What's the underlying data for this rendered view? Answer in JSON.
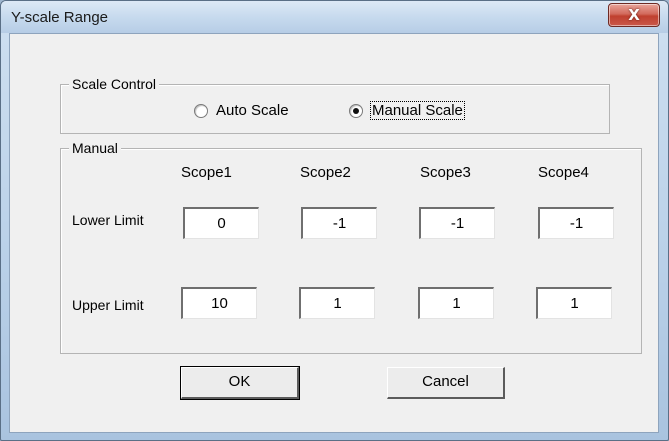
{
  "window": {
    "title": "Y-scale Range",
    "close_label": "X"
  },
  "scale_control": {
    "label": "Scale Control",
    "auto_label": "Auto Scale",
    "manual_label": "Manual Scale",
    "selected": "manual"
  },
  "manual": {
    "label": "Manual",
    "columns": [
      "Scope1",
      "Scope2",
      "Scope3",
      "Scope4"
    ],
    "lower_label": "Lower Limit",
    "upper_label": "Upper Limit",
    "lower_values": [
      "0",
      "-1",
      "-1",
      "-1"
    ],
    "upper_values": [
      "10",
      "1",
      "1",
      "1"
    ]
  },
  "buttons": {
    "ok": "OK",
    "cancel": "Cancel"
  }
}
